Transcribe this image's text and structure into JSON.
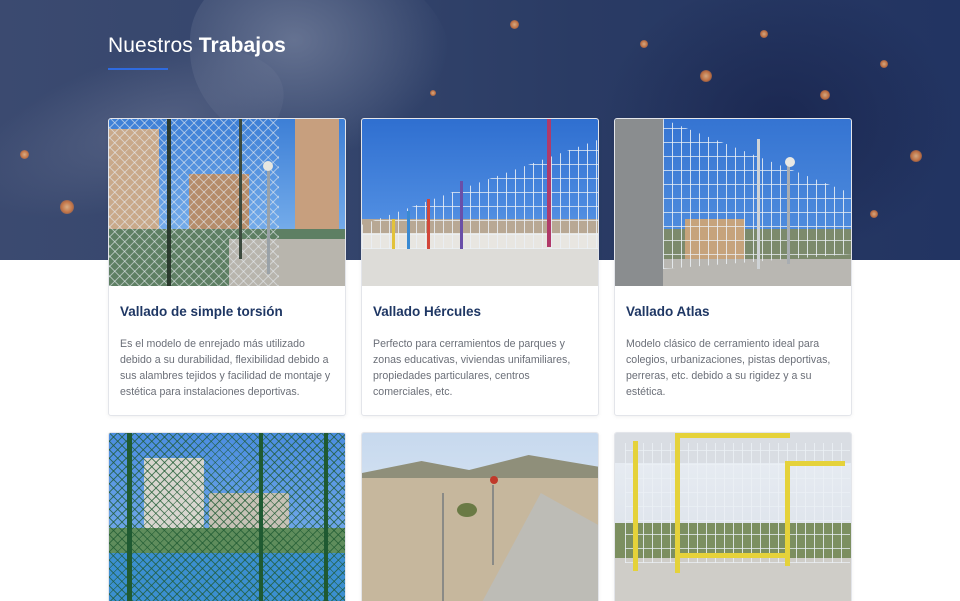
{
  "section": {
    "title_light": "Nuestros",
    "title_bold": "Trabajos"
  },
  "cards": [
    {
      "title": "Vallado de simple torsión",
      "text": "Es el modelo de enrejado más utilizado debido a su durabilidad, flexibilidad debido a sus alambres tejidos y facilidad de montaje y estética para instalaciones deportivas."
    },
    {
      "title": "Vallado Hércules",
      "text": "Perfecto para cerramientos de parques y zonas educativas, viviendas unifamiliares, propiedades particulares, centros comerciales, etc."
    },
    {
      "title": "Vallado Atlas",
      "text": "Modelo clásico de cerramiento ideal para colegios, urbanizaciones, pistas deportivas, perreras, etc. debido a su rigidez y a su estética."
    }
  ],
  "colors": {
    "accent": "#2f6be0",
    "heading": "#1f3764",
    "body_text": "#6b6f78",
    "hero_overlay": "#2a3b64"
  }
}
